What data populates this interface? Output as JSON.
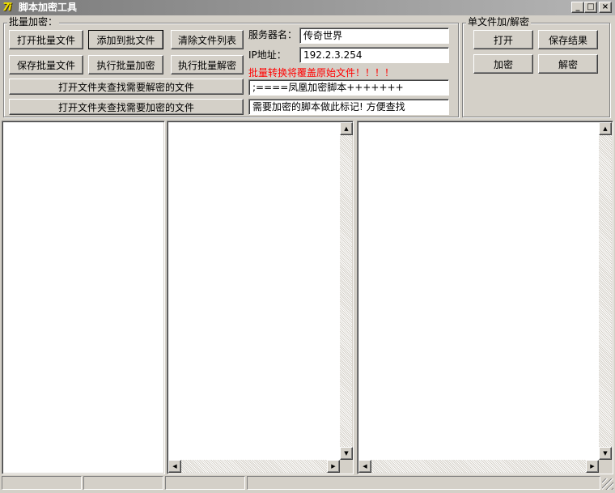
{
  "window": {
    "title": "脚本加密工具",
    "icon_text": "7i",
    "icon": "app-icon",
    "buttons": {
      "minimize": "_",
      "maximize": "□",
      "close": "×"
    }
  },
  "batch": {
    "group_label": "批量加密：",
    "open_batch": "打开批量文件",
    "add_to_batch": "添加到批文件",
    "clear_list": "清除文件列表",
    "save_batch": "保存批量文件",
    "run_encrypt": "执行批量加密",
    "run_decrypt": "执行批量解密",
    "find_decrypt": "打开文件夹查找需要解密的文件",
    "find_encrypt": "打开文件夹查找需要加密的文件"
  },
  "server": {
    "name_label": "服务器名：",
    "name_value": "传奇世界",
    "ip_label": "IP地址：",
    "ip_value": "192.2.3.254",
    "warning": "批量转换将覆盖原始文件！！！！",
    "marker_value": ";====凤凰加密脚本+++++++",
    "hint_value": "需要加密的脚本做此标记! 方便查找"
  },
  "single": {
    "group_label": "单文件加/解密",
    "open": "打开",
    "save_result": "保存结果",
    "encrypt": "加密",
    "decrypt": "解密"
  },
  "scroll_glyphs": {
    "up": "▲",
    "down": "▼",
    "left": "◀",
    "right": "▶"
  },
  "colors": {
    "face": "#d4d0c8",
    "warning": "#ff0000",
    "title_bar": "#7b7b7b"
  }
}
